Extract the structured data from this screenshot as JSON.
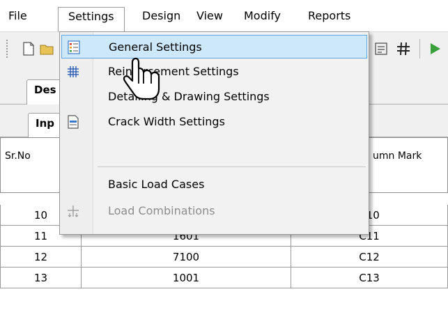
{
  "menubar": {
    "items": [
      "File",
      "Settings",
      "Design",
      "View",
      "Modify",
      "Reports"
    ],
    "open_item": "Settings"
  },
  "toolbar": {
    "icons": [
      "new-file-icon",
      "open-folder-icon",
      "align-icon",
      "grid-hash-icon",
      "run-icon"
    ]
  },
  "tabs": {
    "top": "Des",
    "second": "Inp"
  },
  "table": {
    "headers": [
      "Sr.No",
      "",
      "umn Mark"
    ],
    "rows": [
      {
        "sr": "10",
        "id": "",
        "mark": "C10"
      },
      {
        "sr": "11",
        "id": "1601",
        "mark": "C11"
      },
      {
        "sr": "12",
        "id": "7100",
        "mark": "C12"
      },
      {
        "sr": "13",
        "id": "1001",
        "mark": "C13"
      }
    ]
  },
  "dropdown": {
    "items": [
      {
        "label": "General Settings",
        "icon": "general-settings-icon",
        "highlighted": true,
        "enabled": true
      },
      {
        "label": "Reinforcement Settings",
        "icon": "grid-icon",
        "highlighted": false,
        "enabled": true
      },
      {
        "label": "Detailing & Drawing Settings",
        "icon": "",
        "highlighted": false,
        "enabled": true
      },
      {
        "label": "Crack Width Settings",
        "icon": "crack-width-icon",
        "highlighted": false,
        "enabled": true
      },
      {
        "label": "Basic Load Cases",
        "icon": "",
        "highlighted": false,
        "enabled": true
      },
      {
        "label": "Load Combinations",
        "icon": "load-combination-icon",
        "highlighted": false,
        "enabled": false
      }
    ]
  },
  "colors": {
    "highlight_bg": "#cde8fb",
    "highlight_border": "#5fa8e6",
    "disabled_text": "#8c8c8c"
  }
}
